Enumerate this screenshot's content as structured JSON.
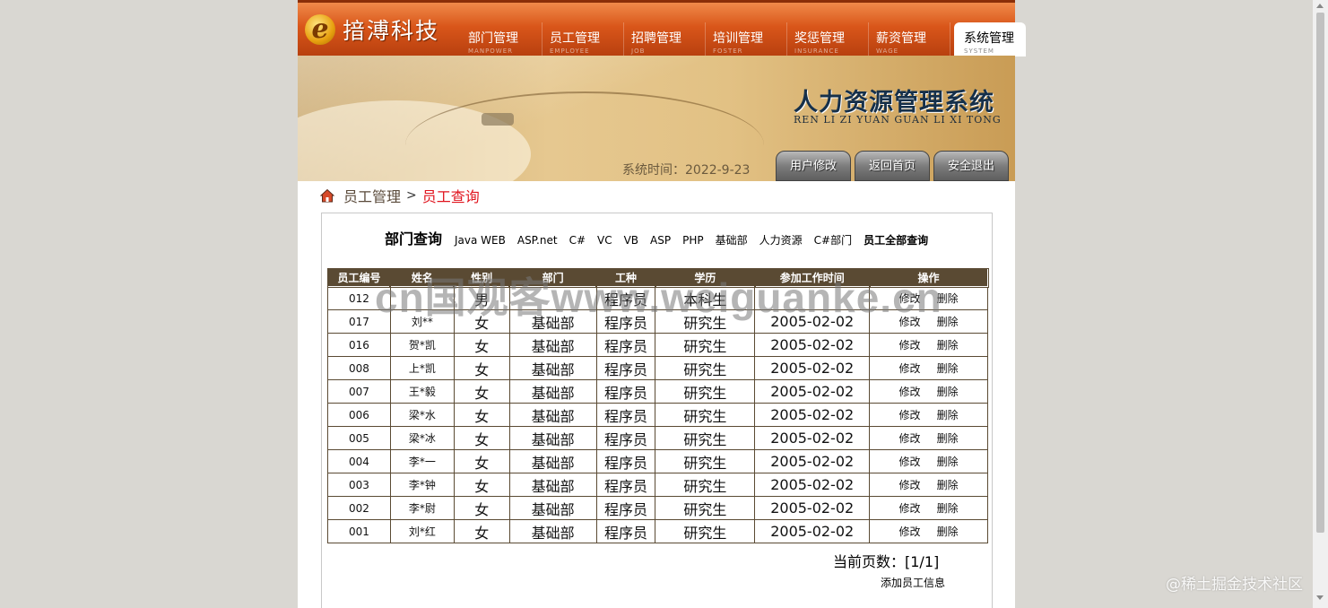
{
  "header": {
    "logo_letter": "e",
    "logo_text": "揞溥科技",
    "nav": [
      {
        "cn": "部门管理",
        "en": "MANPOWER"
      },
      {
        "cn": "员工管理",
        "en": "EMPLOYEE"
      },
      {
        "cn": "招聘管理",
        "en": "JOB"
      },
      {
        "cn": "培训管理",
        "en": "FOSTER"
      },
      {
        "cn": "奖惩管理",
        "en": "INSURANCE"
      },
      {
        "cn": "薪资管理",
        "en": "WAGE"
      },
      {
        "cn": "系统管理",
        "en": "SYSTEM"
      }
    ]
  },
  "banner": {
    "title": "人力资源管理系统",
    "subtitle": "REN LI ZI YUAN GUAN LI XI TONG",
    "systime": "系统时间：2022-9-23",
    "buttons": [
      "用户修改",
      "返回首页",
      "安全退出"
    ]
  },
  "breadcrumb": {
    "parent": "员工管理",
    "sep": ">",
    "current": "员工查询"
  },
  "dept_filter": {
    "label": "部门查询",
    "links": [
      "Java WEB",
      "ASP.net",
      "C#",
      "VC",
      "VB",
      "ASP",
      "PHP",
      "基础部",
      "人力资源",
      "C#部门"
    ],
    "all_link": "员工全部查询"
  },
  "table": {
    "headers": [
      "员工编号",
      "姓名",
      "性别",
      "部门",
      "工种",
      "学历",
      "参加工作时间",
      "操作"
    ],
    "edit_label": "修改",
    "delete_label": "删除",
    "rows": [
      {
        "id": "012",
        "name": "",
        "sex": "男",
        "dept": "",
        "job": "程序员",
        "edu": "本科生",
        "date": ""
      },
      {
        "id": "017",
        "name": "刘**",
        "sex": "女",
        "dept": "基础部",
        "job": "程序员",
        "edu": "研究生",
        "date": "2005-02-02"
      },
      {
        "id": "016",
        "name": "贺*凯",
        "sex": "女",
        "dept": "基础部",
        "job": "程序员",
        "edu": "研究生",
        "date": "2005-02-02"
      },
      {
        "id": "008",
        "name": "上*凯",
        "sex": "女",
        "dept": "基础部",
        "job": "程序员",
        "edu": "研究生",
        "date": "2005-02-02"
      },
      {
        "id": "007",
        "name": "王*毅",
        "sex": "女",
        "dept": "基础部",
        "job": "程序员",
        "edu": "研究生",
        "date": "2005-02-02"
      },
      {
        "id": "006",
        "name": "梁*水",
        "sex": "女",
        "dept": "基础部",
        "job": "程序员",
        "edu": "研究生",
        "date": "2005-02-02"
      },
      {
        "id": "005",
        "name": "梁*冰",
        "sex": "女",
        "dept": "基础部",
        "job": "程序员",
        "edu": "研究生",
        "date": "2005-02-02"
      },
      {
        "id": "004",
        "name": "李*一",
        "sex": "女",
        "dept": "基础部",
        "job": "程序员",
        "edu": "研究生",
        "date": "2005-02-02"
      },
      {
        "id": "003",
        "name": "李*钟",
        "sex": "女",
        "dept": "基础部",
        "job": "程序员",
        "edu": "研究生",
        "date": "2005-02-02"
      },
      {
        "id": "002",
        "name": "李*尉",
        "sex": "女",
        "dept": "基础部",
        "job": "程序员",
        "edu": "研究生",
        "date": "2005-02-02"
      },
      {
        "id": "001",
        "name": "刘*红",
        "sex": "女",
        "dept": "基础部",
        "job": "程序员",
        "edu": "研究生",
        "date": "2005-02-02"
      }
    ]
  },
  "pager": "当前页数：[1/1]",
  "add_link": "添加员工信息",
  "watermark": "cn国观客www.weiguanke.cn",
  "overlay_text": "@稀土掘金技术社区",
  "colors": {
    "nav_orange": "#d9561a",
    "table_header": "#5a4a33",
    "crumb_current": "#e0141e"
  }
}
